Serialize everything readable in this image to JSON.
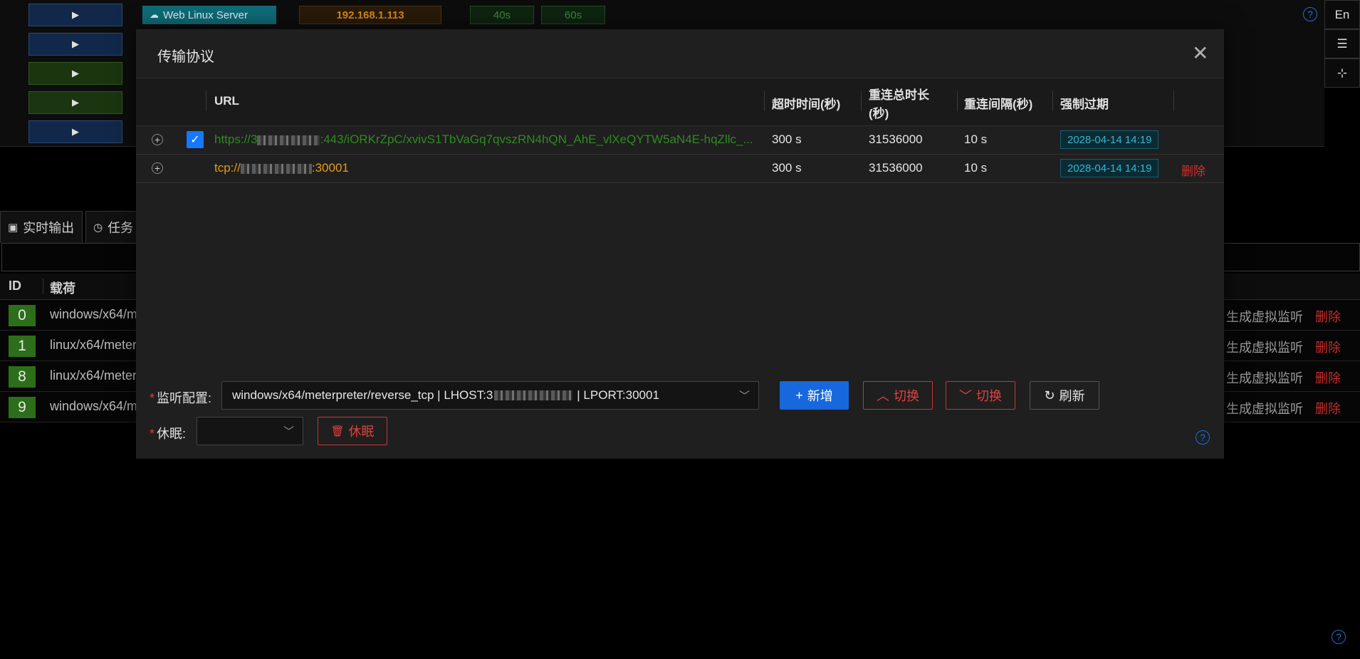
{
  "top_bar": {
    "session_label": "Web Linux Server",
    "ip": "192.168.1.113",
    "interval_1": "40s",
    "interval_2": "60s"
  },
  "right_tools": {
    "lang": "En"
  },
  "bottom_tabs": [
    {
      "label": "实时输出"
    },
    {
      "label": "任务"
    }
  ],
  "bg_table": {
    "headers": [
      "ID",
      "载荷"
    ],
    "rows": [
      {
        "id": "0",
        "payload": "windows/x64/m",
        "gen": "生成虚拟监听",
        "del": "删除"
      },
      {
        "id": "1",
        "payload": "linux/x64/meter",
        "gen": "生成虚拟监听",
        "del": "删除"
      },
      {
        "id": "8",
        "payload": "linux/x64/meter",
        "gen": "生成虚拟监听",
        "del": "删除"
      },
      {
        "id": "9",
        "payload": "windows/x64/m",
        "gen": "生成虚拟监听",
        "del": "删除"
      }
    ]
  },
  "modal": {
    "title": "传输协议",
    "columns": {
      "url": "URL",
      "timeout": "超时时间(秒)",
      "reconnect_total": "重连总时长",
      "reconnect_total_unit": "(秒)",
      "reconnect_interval": "重连间隔(秒)",
      "force_expire": "强制过期"
    },
    "rows": [
      {
        "url_prefix": "https://3",
        "url_suffix": ":443/iORKrZpC/xvivS1TbVaGq7qvszRN4hQN_AhE_vlXeQYTW5aN4E-hqZllc_...",
        "timeout": "300 s",
        "reconnect_total": "31536000",
        "reconnect_interval": "10 s",
        "expire": "2028-04-14 14:19",
        "checked": true,
        "action": ""
      },
      {
        "url_prefix": "tcp://",
        "url_suffix": ":30001",
        "timeout": "300 s",
        "reconnect_total": "31536000",
        "reconnect_interval": "10 s",
        "expire": "2028-04-14 14:19",
        "checked": false,
        "action": "删除"
      }
    ],
    "form": {
      "listener_label": "监听配置:",
      "listener_prefix": "windows/x64/meterpreter/reverse_tcp | LHOST:3",
      "listener_suffix": "| LPORT:30001",
      "add_label": "新增",
      "switch_up_label": "切换",
      "switch_down_label": "切换",
      "refresh_label": "刷新",
      "sleep_label": "休眠:",
      "sleep_value": "",
      "sleep_button_label": "休眠"
    }
  },
  "colors": {
    "primary": "#1668dc",
    "danger": "#d42f2f",
    "url_green": "#2f8a22",
    "url_orange": "#e89a1a",
    "date_tag": "#38b4d4"
  }
}
